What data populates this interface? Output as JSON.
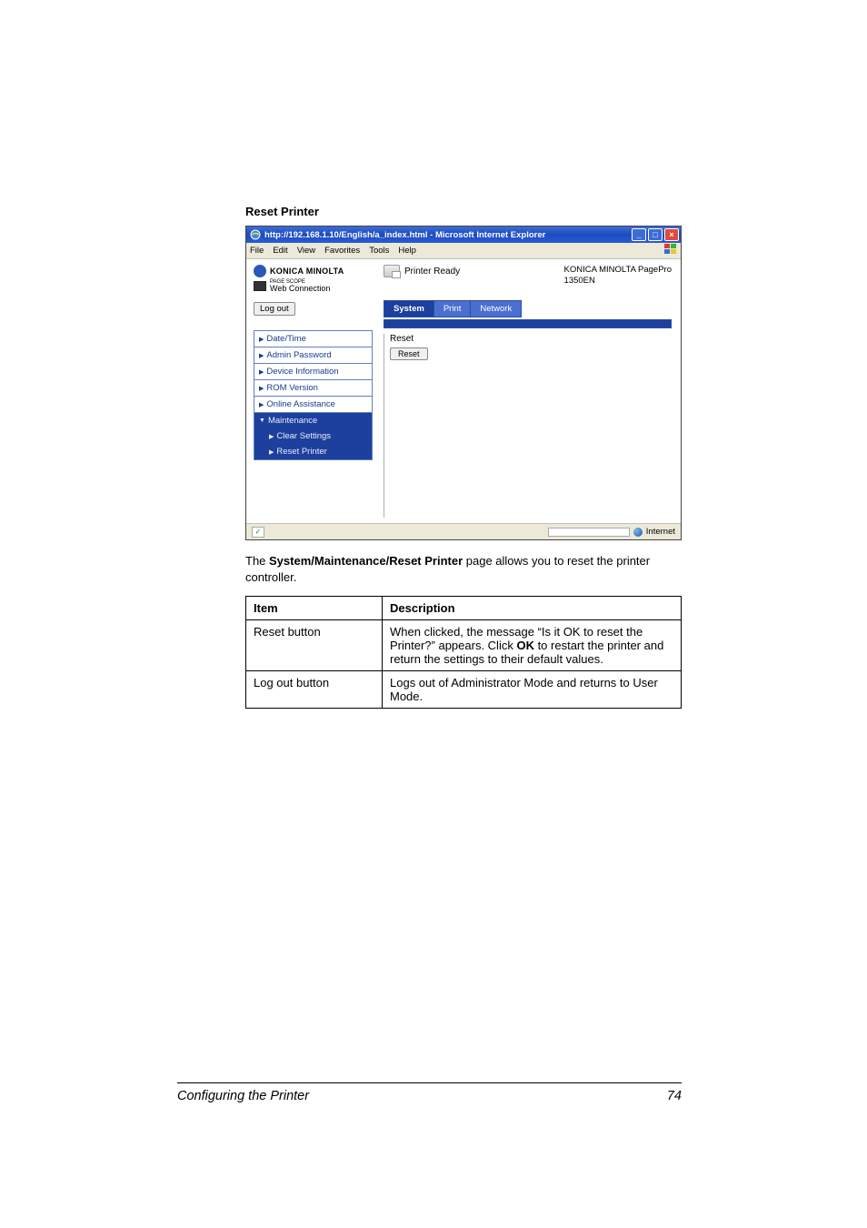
{
  "section_heading": "Reset Printer",
  "screenshot": {
    "title": "http://192.168.1.10/English/a_index.html - Microsoft Internet Explorer",
    "menubar": [
      "File",
      "Edit",
      "View",
      "Favorites",
      "Tools",
      "Help"
    ],
    "brand": "KONICA MINOLTA",
    "psw_prefix": "PAGE SCOPE",
    "psw_label": "Web Connection",
    "logout_label": "Log out",
    "printer_status": "Printer Ready",
    "model_line1": "KONICA MINOLTA PagePro",
    "model_line2": "1350EN",
    "tabs": {
      "system": "System",
      "print": "Print",
      "network": "Network"
    },
    "sidebar": {
      "datetime": "Date/Time",
      "admin_pw": "Admin Password",
      "device_info": "Device Information",
      "rom_version": "ROM Version",
      "online_assist": "Online Assistance",
      "maintenance": "Maintenance",
      "clear_settings": "Clear Settings",
      "reset_printer": "Reset Printer"
    },
    "panel_heading": "Reset",
    "reset_button": "Reset",
    "status_internet": "Internet"
  },
  "body_text_pre": "The ",
  "body_text_bold": "System/Maintenance/Reset Printer",
  "body_text_post": " page allows you to reset the printer controller.",
  "table": {
    "header_item": "Item",
    "header_desc": "Description",
    "rows": [
      {
        "item": "Reset button",
        "desc_pre": "When clicked, the message “Is it OK to reset the Printer?” appears. Click ",
        "desc_bold": "OK",
        "desc_post": " to restart the printer and return the settings to their default values."
      },
      {
        "item": "Log out button",
        "desc_pre": "Logs out of Administrator Mode and returns to User Mode.",
        "desc_bold": "",
        "desc_post": ""
      }
    ]
  },
  "footer": {
    "left": "Configuring the Printer",
    "right": "74"
  }
}
